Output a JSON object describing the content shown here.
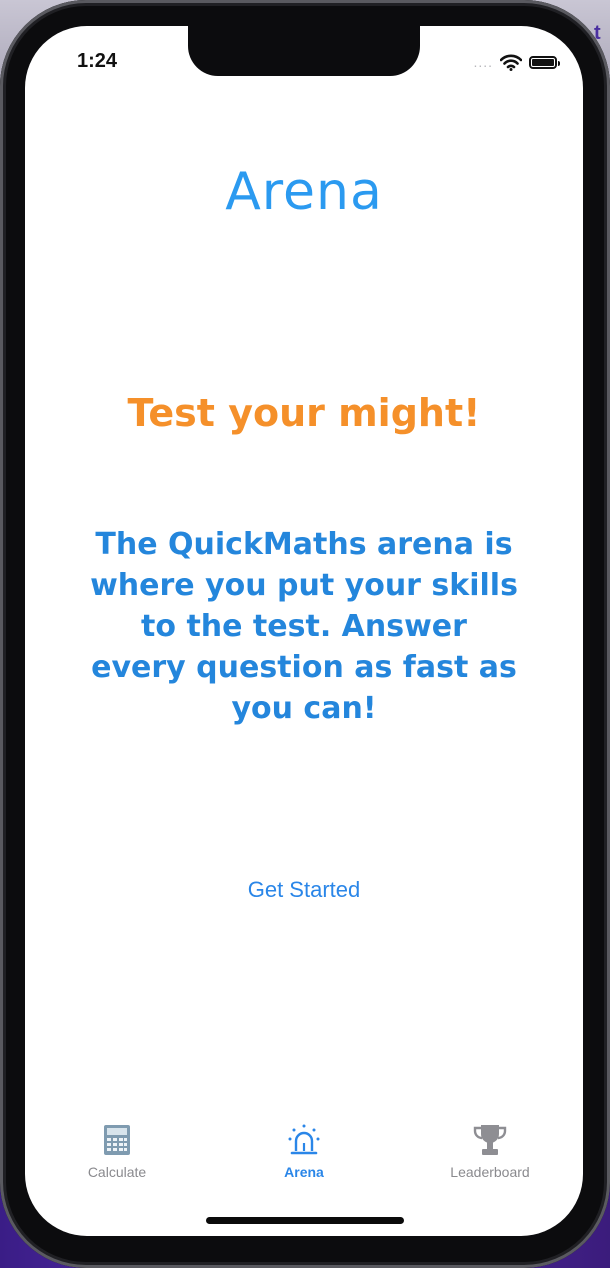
{
  "status": {
    "time": "1:24",
    "signal": "....",
    "icons": [
      "wifi-icon",
      "battery-icon"
    ]
  },
  "main": {
    "title": "Arena",
    "headline": "Test your might!",
    "description": "The QuickMaths arena is where you put your skills to the test. Answer every question as fast as you can!",
    "cta_label": "Get Started"
  },
  "tabbar": {
    "tabs": [
      {
        "label": "Calculate",
        "icon": "calculator-icon",
        "active": false
      },
      {
        "label": "Arena",
        "icon": "siren-icon",
        "active": true
      },
      {
        "label": "Leaderboard",
        "icon": "trophy-icon",
        "active": false
      }
    ]
  },
  "colors": {
    "accent_blue": "#2a86e8",
    "title_blue": "#2b9af0",
    "headline_orange": "#f5902a",
    "inactive_gray": "#8a8a8e"
  }
}
